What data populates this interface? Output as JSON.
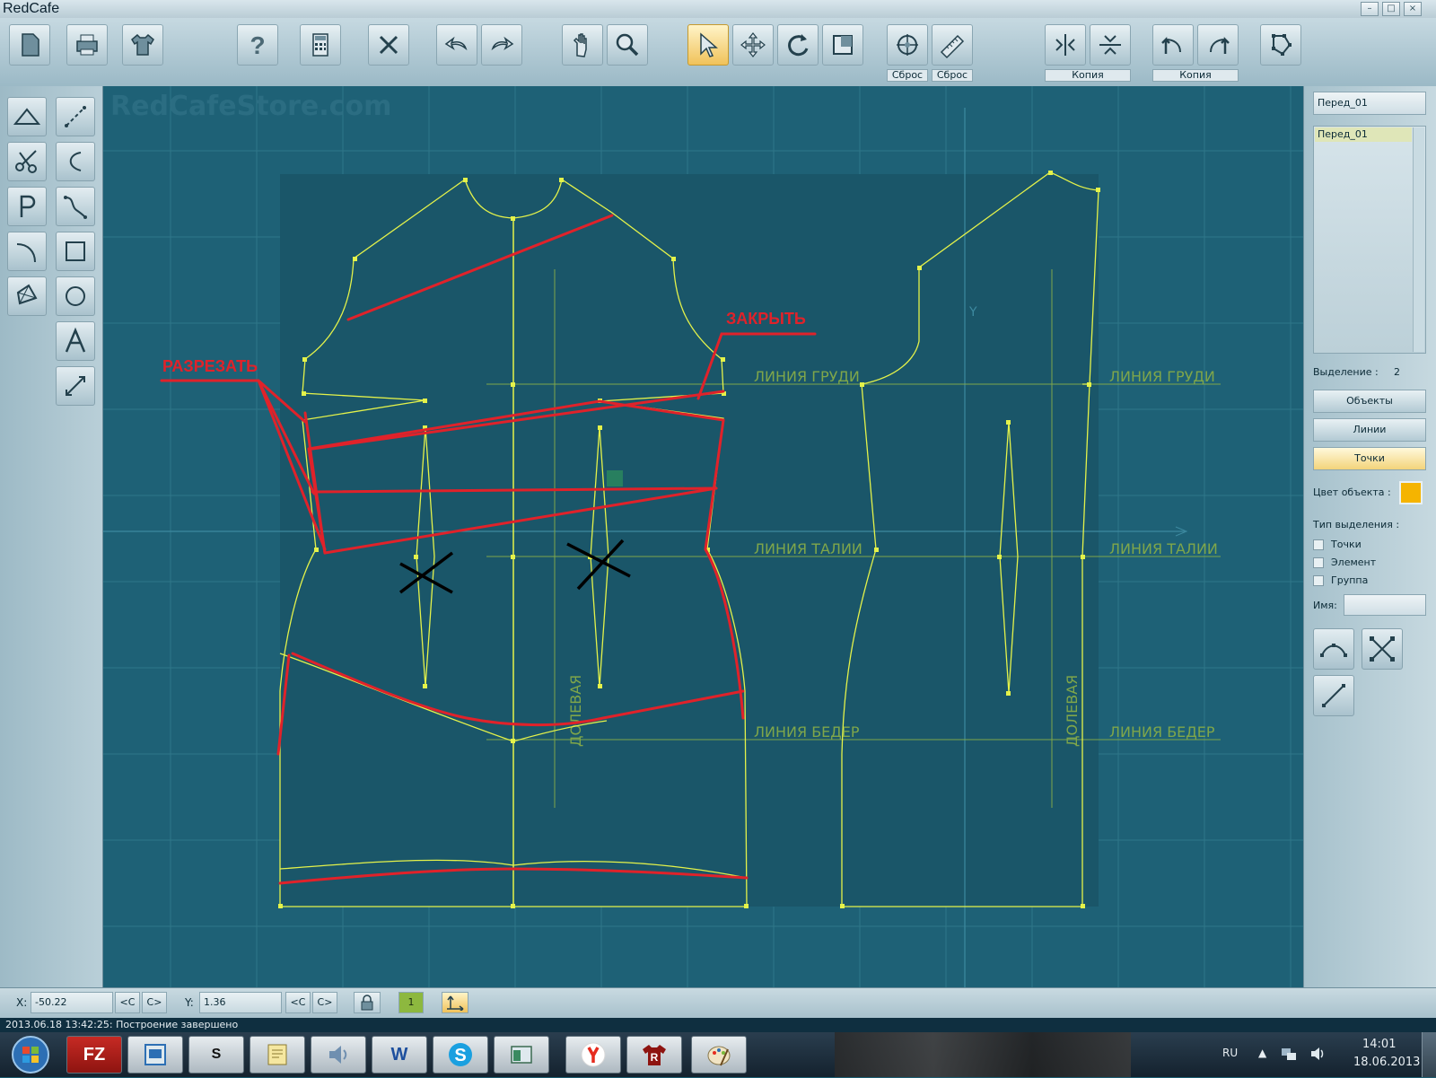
{
  "window": {
    "title": "RedCafe",
    "min": "–",
    "max": "□",
    "close": "×"
  },
  "toolbar": {
    "labels": {
      "reset1": "Сброс",
      "reset2": "Сброс",
      "copy1": "Копия",
      "copy2": "Копия"
    }
  },
  "canvas": {
    "watermark": "RedCafeStore.com",
    "labels": {
      "bust1": "ЛИНИЯ ГРУДИ",
      "bust2": "ЛИНИЯ ГРУДИ",
      "waist1": "ЛИНИЯ ТАЛИИ",
      "waist2": "ЛИНИЯ ТАЛИИ",
      "hip1": "ЛИНИЯ БЕДЕР",
      "hip2": "ЛИНИЯ БЕДЕР",
      "grain1": "ДОЛЕВАЯ",
      "grain2": "ДОЛЕВАЯ",
      "axis_y": "Y"
    },
    "annotations": {
      "cut": "РАЗРЕЗАТЬ",
      "close": "ЗАКРЫТЬ"
    },
    "colors": {
      "pattern": "#e4f24a",
      "annotation": "#e0222a",
      "guide": "#7fa64a",
      "cross": "#000000"
    }
  },
  "right_panel": {
    "object_name": "Перед_01",
    "list_selected": "Перед_01",
    "selection_label": "Выделение :",
    "selection_count": "2",
    "btn_objects": "Объекты",
    "btn_lines": "Линии",
    "btn_points": "Точки",
    "object_color_label": "Цвет объекта :",
    "object_color": "#f5b400",
    "selection_type_label": "Тип выделения :",
    "cb_points": "Точки",
    "cb_element": "Элемент",
    "cb_group": "Группа",
    "name_label": "Имя:"
  },
  "status": {
    "x_label": "X:",
    "x_value": "-50.22",
    "y_label": "Y:",
    "y_value": "1.36",
    "prev": "<C",
    "next": "C>",
    "layer": "1"
  },
  "message": "2013.06.18 13:42:25: Построение завершено",
  "taskbar": {
    "lang": "RU",
    "time": "14:01",
    "date": "18.06.2013"
  }
}
